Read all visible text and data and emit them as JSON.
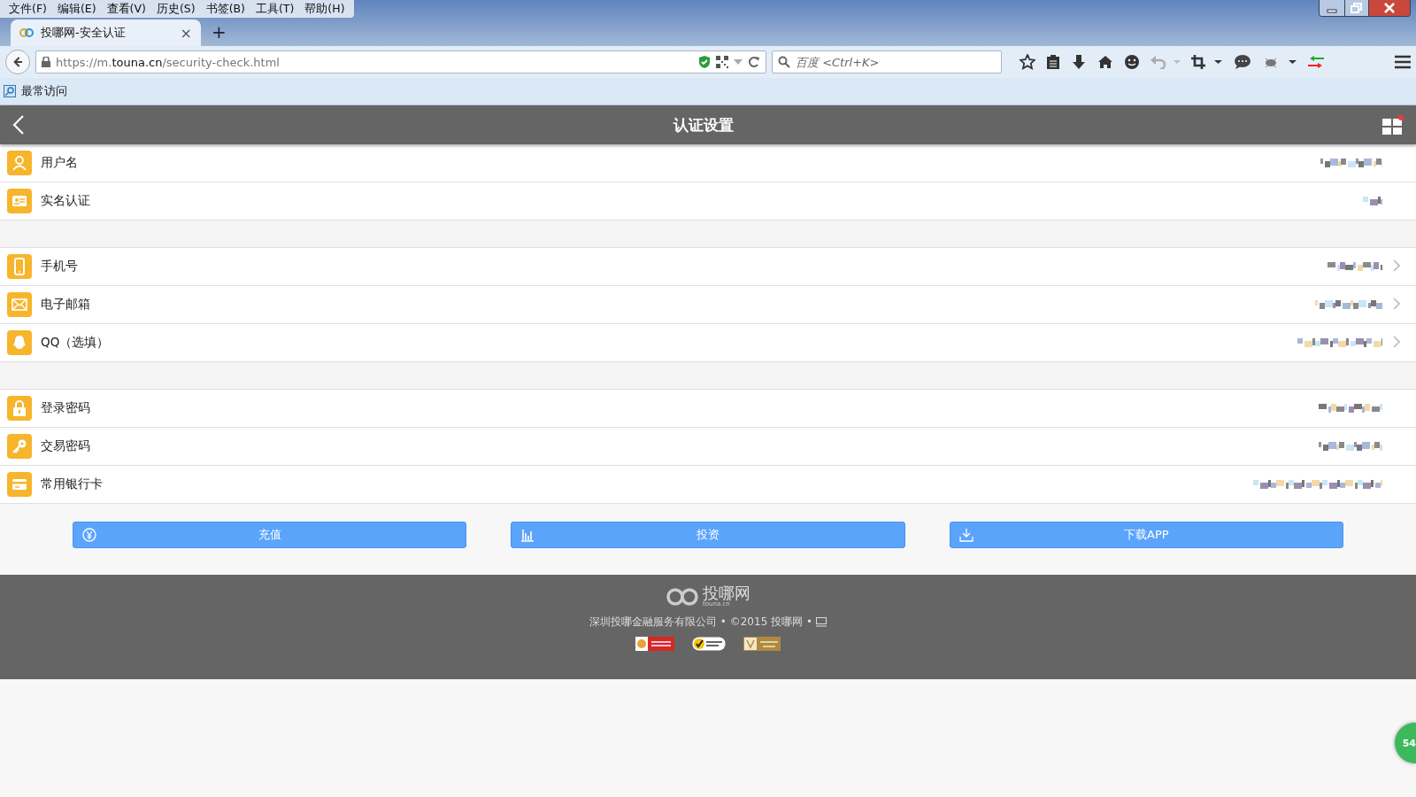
{
  "menu_bar": [
    "文件(F)",
    "编辑(E)",
    "查看(V)",
    "历史(S)",
    "书签(B)",
    "工具(T)",
    "帮助(H)"
  ],
  "tab": {
    "title": "投哪网-安全认证",
    "close": "×",
    "selected": true
  },
  "new_tab": "+",
  "address": "https://m.**touna.cn**/security-check.html",
  "search": {
    "placeholder": "百度 <Ctrl+K>"
  },
  "bookmarks": [
    "最常访问"
  ],
  "header": {
    "title": "认证设置"
  },
  "groups": [
    [
      {
        "label": "用户名",
        "linked": false
      },
      {
        "label": "实名认证",
        "linked": false
      }
    ],
    [
      {
        "label": "手机号",
        "linked": true
      },
      {
        "label": "电子邮箱",
        "linked": true
      },
      {
        "label": "QQ（选填）",
        "linked": true
      }
    ],
    [
      {
        "label": "登录密码",
        "linked": false
      },
      {
        "label": "交易密码",
        "linked": false
      },
      {
        "label": "常用银行卡",
        "linked": false
      }
    ]
  ],
  "actions": [
    {
      "label": "充值"
    },
    {
      "label": "投资"
    },
    {
      "label": "下载APP"
    }
  ],
  "footer": {
    "logo": "投哪网",
    "logo_sub": "touna.cn",
    "copyright": "深圳投哪金融服务有限公司 • ©2015 投哪网 •"
  },
  "float_badge": "54"
}
